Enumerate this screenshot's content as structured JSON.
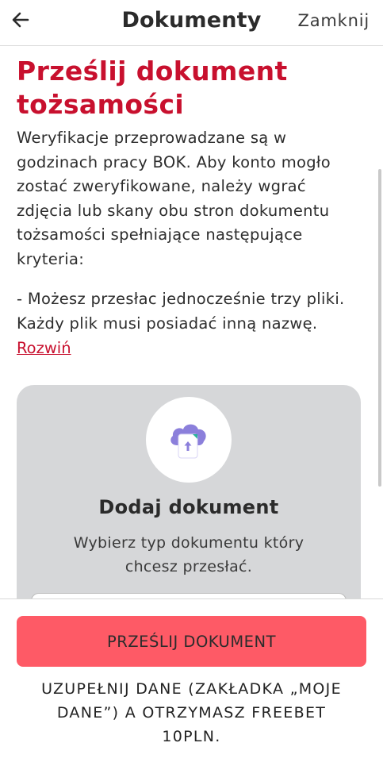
{
  "header": {
    "title": "Dokumenty",
    "close_label": "Zamknij",
    "back_icon": "arrow-left-icon"
  },
  "main": {
    "title": "Prześlij dokument tożsamości",
    "description": "Weryfikacje przeprowadzane są w godzinach pracy BOK. Aby konto mogło zostać zweryfikowane, należy wgrać zdjęcia lub skany obu stron dokumentu tożsamości spełniające następujące kryteria:",
    "criteria": "- Możesz przesłac jednocześnie trzy pliki. Każdy plik musi posiadać inną nazwę.",
    "expand_label": "Rozwiń"
  },
  "upload_card": {
    "icon": "cloud-upload-document-icon",
    "title": "Dodaj dokument",
    "subtitle": "Wybierz typ dokumentu który chcesz przesłać."
  },
  "footer": {
    "submit_label": "PRZEŚLIJ DOKUMENT",
    "promo_text": "UZUPEŁNIJ DANE (ZAKŁADKA „MOJE DANE”) A OTRZYMASZ FREEBET 10PLN."
  },
  "colors": {
    "brand_red": "#c8102e",
    "button_coral": "#fe5a66",
    "card_gray": "#d6d7d9",
    "icon_purple": "#8b7fdb",
    "icon_teal": "#2bb39b"
  }
}
